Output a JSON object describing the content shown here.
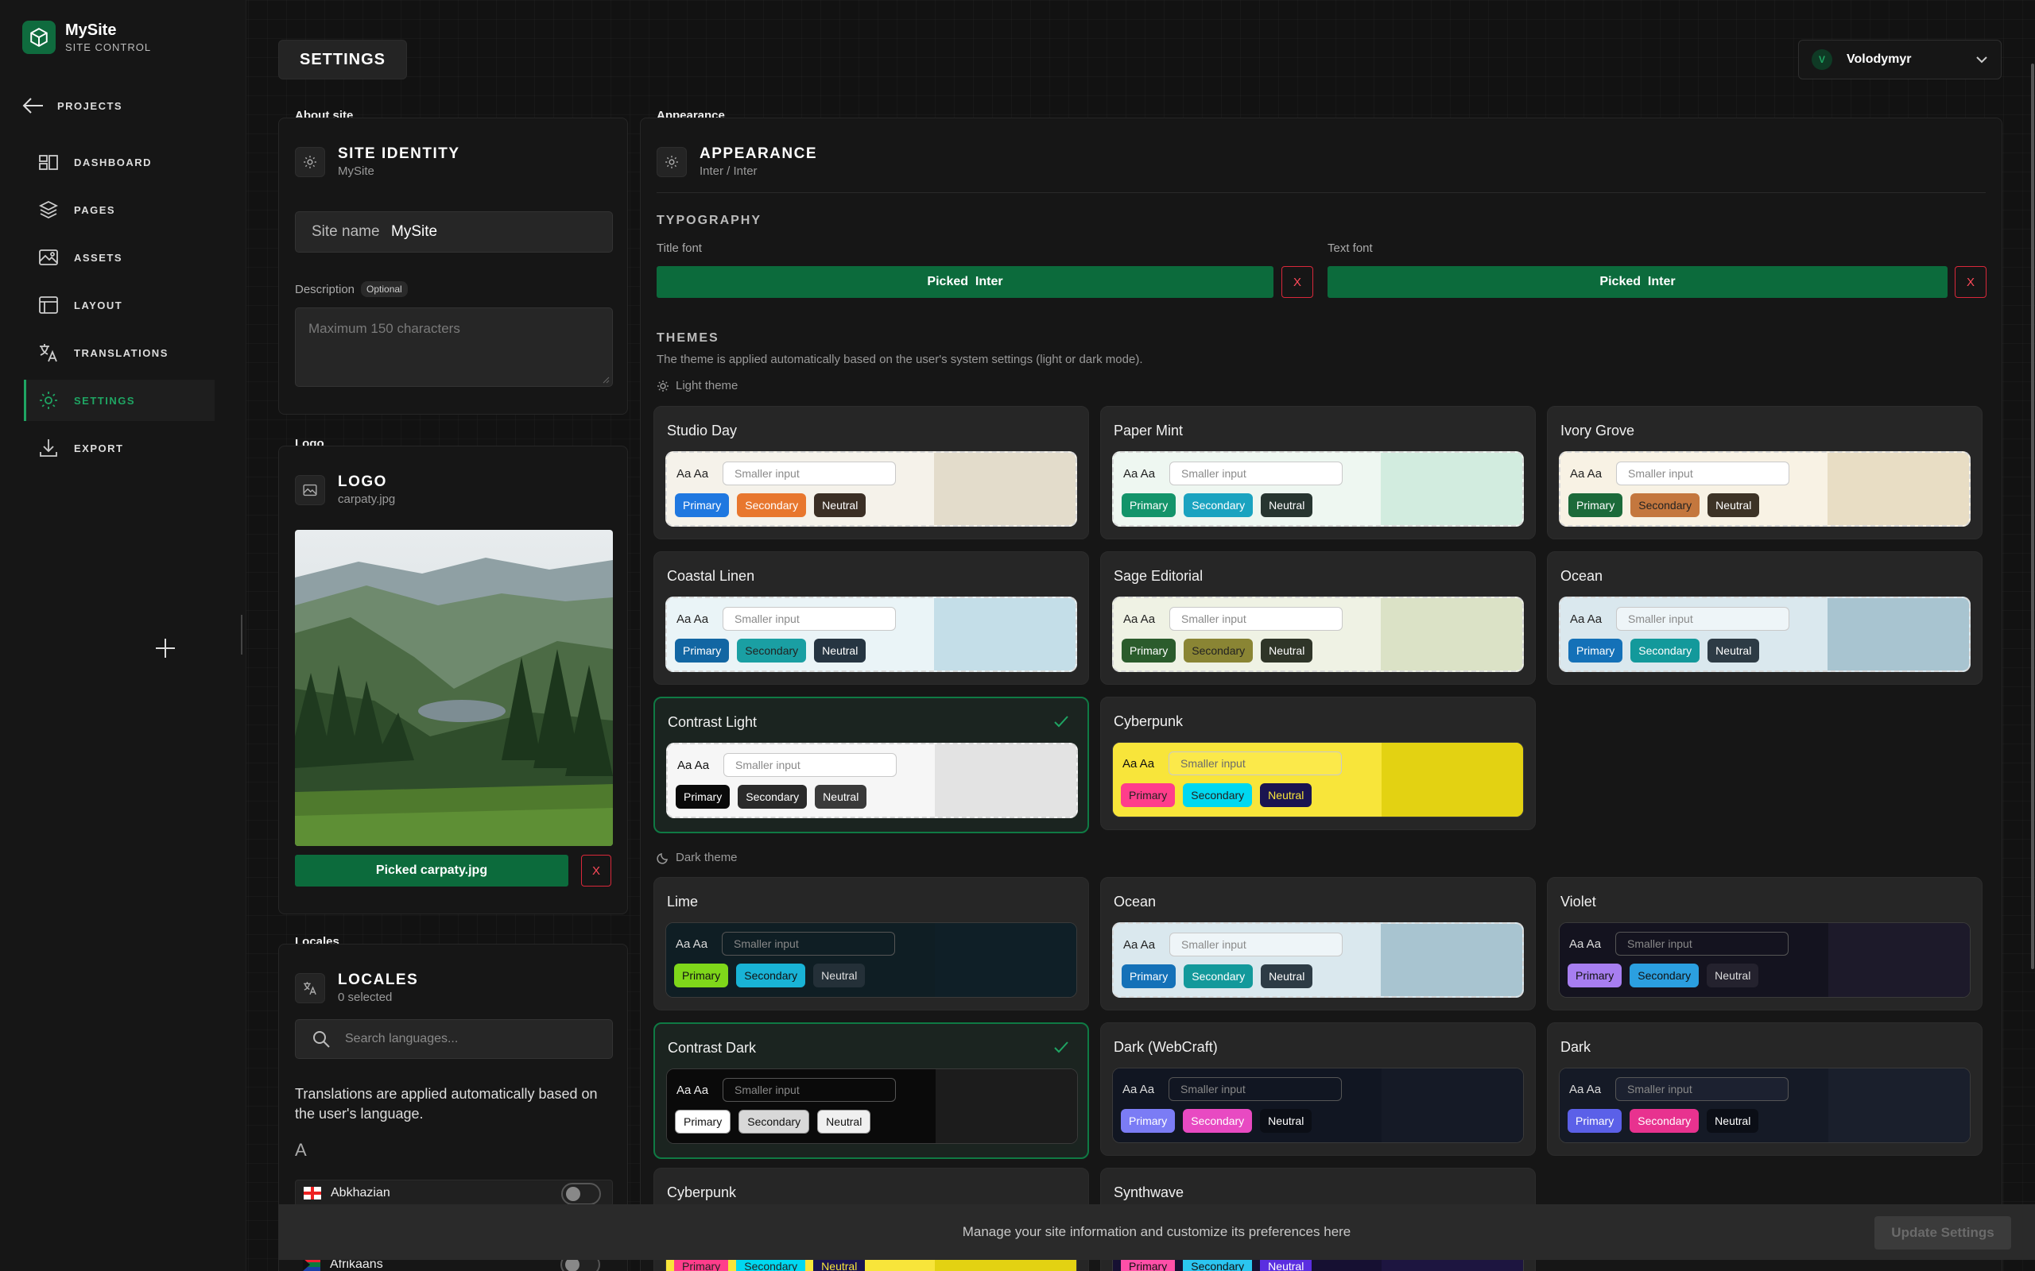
{
  "brand": {
    "name": "MySite",
    "subtitle": "SITE CONTROL"
  },
  "nav": {
    "back_label": "PROJECTS",
    "items": [
      {
        "label": "DASHBOARD",
        "icon": "dashboard-icon"
      },
      {
        "label": "PAGES",
        "icon": "layers-icon"
      },
      {
        "label": "ASSETS",
        "icon": "image-icon"
      },
      {
        "label": "LAYOUT",
        "icon": "layout-icon"
      },
      {
        "label": "TRANSLATIONS",
        "icon": "translate-icon"
      },
      {
        "label": "SETTINGS",
        "icon": "gear-icon",
        "active": true
      },
      {
        "label": "EXPORT",
        "icon": "download-icon"
      }
    ]
  },
  "header": {
    "title": "SETTINGS",
    "user_initial": "V",
    "user_name": "Volodymyr"
  },
  "about": {
    "section": "About site",
    "title": "SITE IDENTITY",
    "subtitle": "MySite",
    "site_name_label": "Site name",
    "site_name_value": "MySite",
    "description_label": "Description",
    "optional_badge": "Optional",
    "description_placeholder": "Maximum 150 characters"
  },
  "logo": {
    "section": "Logo",
    "title": "LOGO",
    "subtitle": "carpaty.jpg",
    "picked_label": "Picked carpaty.jpg",
    "remove_label": "X"
  },
  "locales": {
    "section": "Locales",
    "title": "LOCALES",
    "subtitle": "0 selected",
    "search_placeholder": "Search languages...",
    "info": "Translations are applied automatically based on the user's language.",
    "group_letter": "A",
    "items": [
      {
        "name": "Abkhazian",
        "flag": "georgia-flag"
      },
      {
        "name": "Afrikaans",
        "flag": "south-africa-flag"
      }
    ]
  },
  "appearance": {
    "section": "Appearance",
    "title": "APPEARANCE",
    "subtitle": "Inter / Inter",
    "typography_heading": "TYPOGRAPHY",
    "title_font_label": "Title font",
    "title_font_value": "Picked  Inter",
    "text_font_label": "Text font",
    "text_font_value": "Picked  Inter",
    "remove_label": "X",
    "themes_heading": "THEMES",
    "themes_note": "The theme is applied automatically based on the user's system settings (light or dark mode).",
    "light_label": "Light theme",
    "dark_label": "Dark theme"
  },
  "theme_preview": {
    "aa": "Aa Aa",
    "input_placeholder": "Smaller input",
    "primary": "Primary",
    "secondary": "Secondary",
    "neutral": "Neutral"
  },
  "light_themes": [
    {
      "name": "Studio Day",
      "bg": "#f5f2ea",
      "right": "#e3dccb",
      "aa": "#222",
      "input_bg": "#ffffff",
      "input_text": "#8a8a8a",
      "primary": "#1f78e0",
      "primary_text": "#fff",
      "secondary": "#e8772e",
      "secondary_text": "#fff",
      "neutral": "#3b2f25",
      "neutral_text": "#fff",
      "dashed": true,
      "selected": false
    },
    {
      "name": "Paper Mint",
      "bg": "#eef7f1",
      "right": "#d2ecdf",
      "aa": "#222",
      "input_bg": "#ffffff",
      "input_text": "#8a8a8a",
      "primary": "#13946a",
      "primary_text": "#fff",
      "secondary": "#1aa3c0",
      "secondary_text": "#fff",
      "neutral": "#273530",
      "neutral_text": "#fff",
      "dashed": true,
      "selected": false
    },
    {
      "name": "Ivory Grove",
      "bg": "#f8f2e4",
      "right": "#e8ddc4",
      "aa": "#222",
      "input_bg": "#ffffff",
      "input_text": "#8a8a8a",
      "primary": "#1c6a3a",
      "primary_text": "#fff",
      "secondary": "#c4773e",
      "secondary_text": "#222",
      "neutral": "#3d3326",
      "neutral_text": "#fff",
      "dashed": true,
      "selected": false
    },
    {
      "name": "Coastal Linen",
      "bg": "#eaf4f7",
      "right": "#c4dee8",
      "aa": "#222",
      "input_bg": "#ffffff",
      "input_text": "#8a8a8a",
      "primary": "#1266a3",
      "primary_text": "#fff",
      "secondary": "#1a9fa3",
      "secondary_text": "#222",
      "neutral": "#263542",
      "neutral_text": "#fff",
      "dashed": true,
      "selected": false
    },
    {
      "name": "Sage Editorial",
      "bg": "#eff2e4",
      "right": "#dbe2c6",
      "aa": "#222",
      "input_bg": "#ffffff",
      "input_text": "#8a8a8a",
      "primary": "#2b5c2c",
      "primary_text": "#fff",
      "secondary": "#8a8534",
      "secondary_text": "#222",
      "neutral": "#2f3528",
      "neutral_text": "#fff",
      "dashed": true,
      "selected": false
    },
    {
      "name": "Ocean",
      "bg": "#dae8ee",
      "right": "#a8c4d0",
      "aa": "#222",
      "input_bg": "#eef5f8",
      "input_text": "#8a8a8a",
      "primary": "#1471b8",
      "primary_text": "#fff",
      "secondary": "#13999b",
      "secondary_text": "#fff",
      "neutral": "#2d3b45",
      "neutral_text": "#fff",
      "dashed": true,
      "selected": false
    },
    {
      "name": "Contrast Light",
      "bg": "#f6f6f6",
      "right": "#e3e3e3",
      "aa": "#111",
      "input_bg": "#ffffff",
      "input_text": "#8a8a8a",
      "primary": "#0a0a0a",
      "primary_text": "#fff",
      "secondary": "#2a2a2a",
      "secondary_text": "#fff",
      "neutral": "#3a3a3a",
      "neutral_text": "#fff",
      "dashed": true,
      "selected": true
    },
    {
      "name": "Cyberpunk",
      "bg": "#f8e53a",
      "right": "#e3d212",
      "aa": "#111",
      "input_bg": "#fbe94a",
      "input_text": "#6b6b6b",
      "primary": "#ff3d8b",
      "primary_text": "#222",
      "secondary": "#00d8f0",
      "secondary_text": "#222",
      "neutral": "#1a1450",
      "neutral_text": "#f8e53a",
      "dashed": false,
      "selected": false
    }
  ],
  "dark_themes": [
    {
      "name": "Lime",
      "bg": "#0f1e24",
      "right": "#0f1f27",
      "aa": "#ddd",
      "input_bg": "#0f1e24",
      "input_text": "#888",
      "primary": "#7fd71a",
      "primary_text": "#111",
      "secondary": "#19b3d6",
      "secondary_text": "#111",
      "neutral": "#243038",
      "neutral_text": "#ddd",
      "dashed": false,
      "selected": false
    },
    {
      "name": "Ocean",
      "bg": "#dae8ee",
      "right": "#a8c4d0",
      "aa": "#222",
      "input_bg": "#eef5f8",
      "input_text": "#8a8a8a",
      "primary": "#1471b8",
      "primary_text": "#fff",
      "secondary": "#13999b",
      "secondary_text": "#fff",
      "neutral": "#2d3b45",
      "neutral_text": "#fff",
      "dashed": true,
      "selected": false
    },
    {
      "name": "Violet",
      "bg": "#14131f",
      "right": "#1d1a2a",
      "aa": "#ddd",
      "input_bg": "#14131f",
      "input_text": "#888",
      "primary": "#a77ef0",
      "primary_text": "#111",
      "secondary": "#2b9fe0",
      "secondary_text": "#111",
      "neutral": "#24222e",
      "neutral_text": "#ddd",
      "dashed": false,
      "selected": false
    },
    {
      "name": "Contrast Dark",
      "bg": "#0a0a0a",
      "right": "#1c1c1c",
      "aa": "#eee",
      "input_bg": "#0a0a0a",
      "input_text": "#888",
      "primary": "#ffffff",
      "primary_text": "#111",
      "secondary": "#d8d8d8",
      "secondary_text": "#111",
      "neutral": "#f0f0f0",
      "neutral_text": "#111",
      "dashed": false,
      "selected": true
    },
    {
      "name": "Dark (WebCraft)",
      "bg": "#111622",
      "right": "#151a26",
      "aa": "#ddd",
      "input_bg": "#111622",
      "input_text": "#888",
      "primary": "#7b7cf5",
      "primary_text": "#fff",
      "secondary": "#e84ac2",
      "secondary_text": "#fff",
      "neutral": "#0b0e16",
      "neutral_text": "#fff",
      "dashed": false,
      "selected": false
    },
    {
      "name": "Dark",
      "bg": "#151a26",
      "right": "#1a1f2c",
      "aa": "#ddd",
      "input_bg": "#1c2130",
      "input_text": "#888",
      "primary": "#5b60e8",
      "primary_text": "#fff",
      "secondary": "#e8328f",
      "secondary_text": "#fff",
      "neutral": "#0b0e16",
      "neutral_text": "#fff",
      "dashed": false,
      "selected": false
    },
    {
      "name": "Cyberpunk",
      "bg": "#f8e53a",
      "right": "#e3d212",
      "aa": "#111",
      "input_bg": "#fbe94a",
      "input_text": "#6b6b6b",
      "primary": "#ff3d8b",
      "primary_text": "#222",
      "secondary": "#00d8f0",
      "secondary_text": "#222",
      "neutral": "#1a1450",
      "neutral_text": "#f8e53a",
      "dashed": false,
      "selected": false
    },
    {
      "name": "Synthwave",
      "bg": "#161032",
      "right": "#1d1540",
      "aa": "#ddd",
      "input_bg": "#161032",
      "input_text": "#888",
      "primary": "#ff4fa8",
      "primary_text": "#111",
      "secondary": "#2bc5f0",
      "secondary_text": "#111",
      "neutral": "#5a2ee0",
      "neutral_text": "#fff",
      "dashed": false,
      "selected": false
    }
  ],
  "footer": {
    "message": "Manage your site information and customize its preferences here",
    "update_label": "Update Settings"
  }
}
